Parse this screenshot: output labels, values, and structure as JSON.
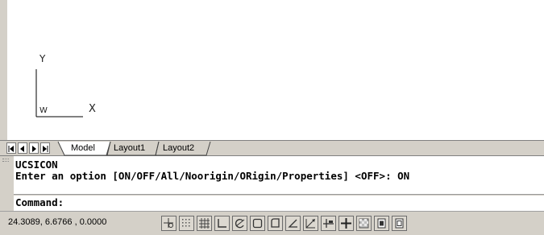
{
  "drawing": {
    "ucs": {
      "y_label": "Y",
      "x_label": "X",
      "w_label": "W"
    }
  },
  "tabs": {
    "nav_buttons": [
      "first-layout-button",
      "previous-layout-button",
      "next-layout-button",
      "last-layout-button"
    ],
    "items": [
      {
        "label": "Model",
        "active": true
      },
      {
        "label": "Layout1",
        "active": false
      },
      {
        "label": "Layout2",
        "active": false
      }
    ]
  },
  "command": {
    "history": [
      "UCSICON",
      "Enter an option [ON/OFF/All/Noorigin/ORigin/Properties] <OFF>: ON"
    ],
    "prompt": "Command:"
  },
  "status": {
    "coordinates": "24.3089, 6.6766 , 0.0000",
    "buttons": [
      {
        "name": "infer-constraints-icon",
        "active": false
      },
      {
        "name": "snap-mode-icon",
        "active": false
      },
      {
        "name": "grid-display-icon",
        "active": false
      },
      {
        "name": "ortho-mode-icon",
        "active": false
      },
      {
        "name": "polar-tracking-icon",
        "active": false
      },
      {
        "name": "object-snap-icon",
        "active": false
      },
      {
        "name": "3d-object-snap-icon",
        "active": false
      },
      {
        "name": "object-snap-tracking-icon",
        "active": false
      },
      {
        "name": "dynamic-ucs-icon",
        "active": false
      },
      {
        "name": "dynamic-input-icon",
        "active": false
      },
      {
        "name": "lineweight-icon",
        "active": false
      },
      {
        "name": "transparency-icon",
        "active": false
      },
      {
        "name": "quick-properties-icon",
        "active": false
      },
      {
        "name": "selection-cycling-icon",
        "active": false
      }
    ]
  }
}
